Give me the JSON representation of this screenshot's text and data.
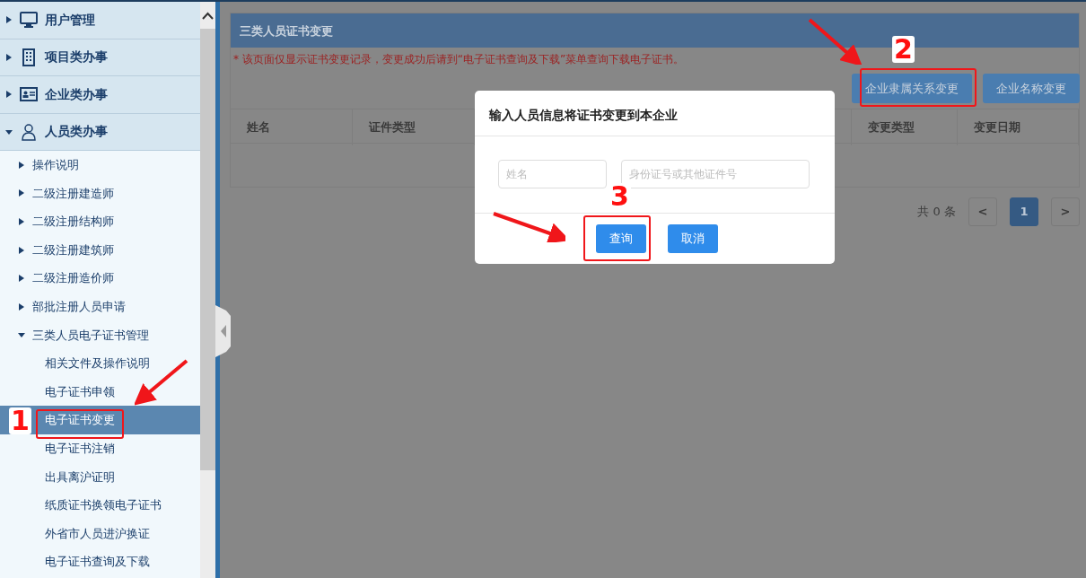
{
  "sidebar": {
    "groups": [
      {
        "label": "用户管理",
        "expanded": false
      },
      {
        "label": "项目类办事",
        "expanded": false
      },
      {
        "label": "企业类办事",
        "expanded": false
      },
      {
        "label": "人员类办事",
        "expanded": true,
        "children": [
          {
            "label": "操作说明",
            "expanded": false
          },
          {
            "label": "二级注册建造师",
            "expanded": false
          },
          {
            "label": "二级注册结构师",
            "expanded": false
          },
          {
            "label": "二级注册建筑师",
            "expanded": false
          },
          {
            "label": "二级注册造价师",
            "expanded": false
          },
          {
            "label": "部批注册人员申请",
            "expanded": false
          },
          {
            "label": "三类人员电子证书管理",
            "expanded": true,
            "children": [
              {
                "label": "相关文件及操作说明",
                "selected": false
              },
              {
                "label": "电子证书申领",
                "selected": false
              },
              {
                "label": "电子证书变更",
                "selected": true
              },
              {
                "label": "电子证书注销",
                "selected": false
              },
              {
                "label": "出具离沪证明",
                "selected": false
              },
              {
                "label": "纸质证书换领电子证书",
                "selected": false
              },
              {
                "label": "外省市人员进沪换证",
                "selected": false
              },
              {
                "label": "电子证书查询及下载",
                "selected": false
              }
            ]
          }
        ]
      }
    ]
  },
  "panel": {
    "title": "三类人员证书变更",
    "note": "* 该页面仅显示证书变更记录，变更成功后请到“电子证书查询及下载”菜单查询下载电子证书。",
    "buttons": [
      "企业隶属关系变更",
      "企业名称变更"
    ],
    "table": {
      "columns": [
        "姓名",
        "证件类型",
        "",
        "变更类型",
        "变更日期"
      ]
    },
    "pagination": {
      "total": "共 0 条",
      "prev": "<",
      "pages": [
        {
          "label": "1",
          "selected": true
        }
      ],
      "next": ">"
    }
  },
  "dialog": {
    "title": "输入人员信息将证书变更到本企业",
    "fields": [
      {
        "placeholder": "姓名"
      },
      {
        "placeholder": "身份证号或其他证件号"
      }
    ],
    "buttons": [
      "查询",
      "取消"
    ]
  },
  "annotations": [
    {
      "number": "1"
    },
    {
      "number": "2"
    },
    {
      "number": "3"
    }
  ]
}
